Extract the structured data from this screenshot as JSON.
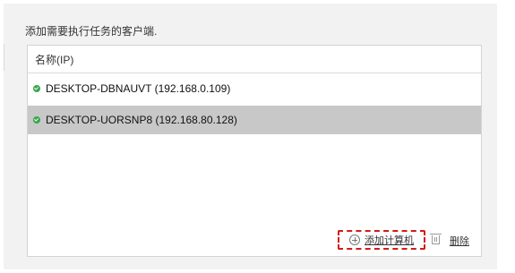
{
  "instruction": "添加需要执行任务的客户端.",
  "table": {
    "header": "名称(IP)",
    "rows": [
      {
        "label": "DESKTOP-DBNAUVT (192.168.0.109)",
        "status": "online",
        "selected": false
      },
      {
        "label": "DESKTOP-UORSNP8 (192.168.80.128)",
        "status": "online",
        "selected": true
      }
    ]
  },
  "actions": {
    "add_label": "添加计算机",
    "delete_label": "删除"
  },
  "colors": {
    "status_online": "#3aa64c",
    "selected_row": "#c8c8c8",
    "highlight": "#d11a1a"
  }
}
